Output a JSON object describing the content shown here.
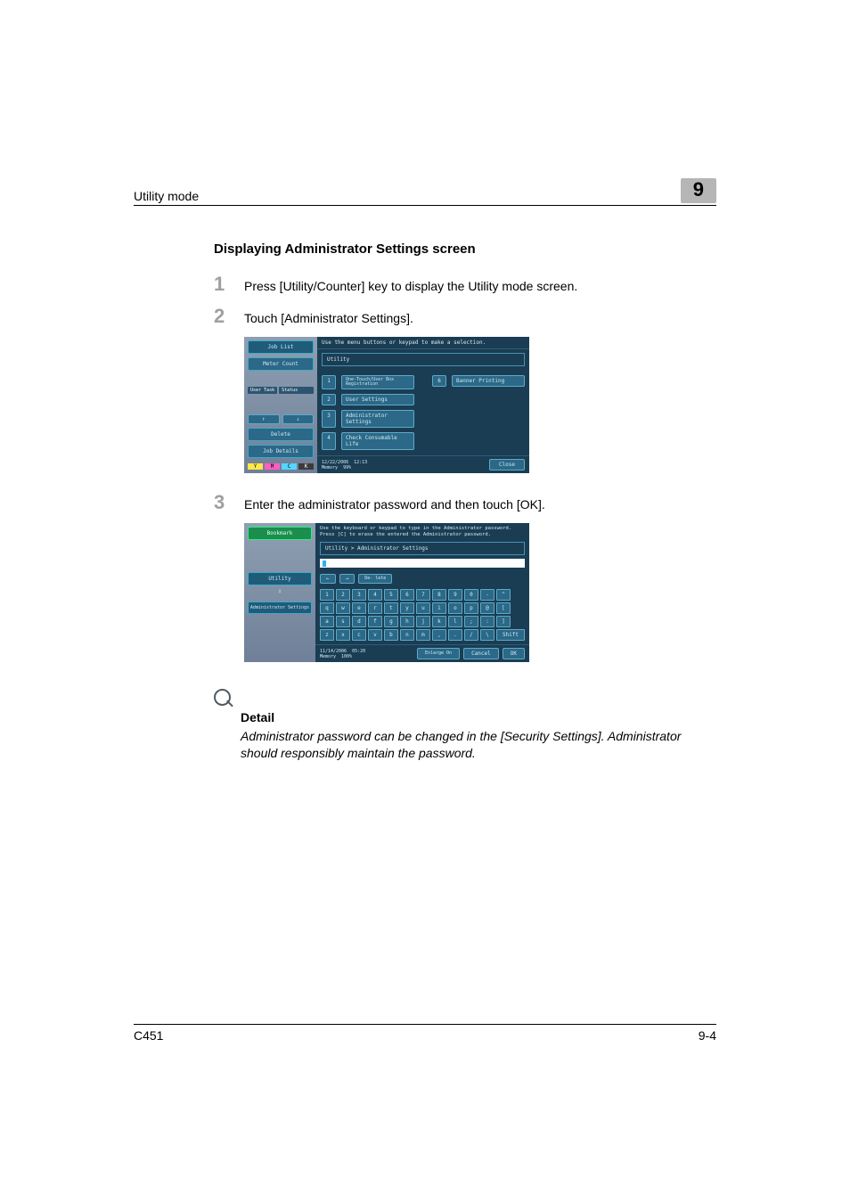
{
  "header": {
    "section": "Utility mode",
    "chapter": "9"
  },
  "section_title": "Displaying Administrator Settings screen",
  "steps": {
    "s1": {
      "num": "1",
      "text": "Press [Utility/Counter] key to display the Utility mode screen."
    },
    "s2": {
      "num": "2",
      "text": "Touch [Administrator Settings]."
    },
    "s3": {
      "num": "3",
      "text": "Enter the administrator password and then touch [OK]."
    }
  },
  "shot1": {
    "side": {
      "job_list": "Job List",
      "meter_count": "Meter Count",
      "user_task": "User Task",
      "status": "Status",
      "up": "↑",
      "down": "↓",
      "delete": "Delete",
      "job_details": "Job Details",
      "y": "Y",
      "m": "M",
      "c": "C",
      "k": "K"
    },
    "instr": "Use the menu buttons or keypad to make a selection.",
    "title": "Utility",
    "items": [
      {
        "num": "1",
        "label": "One-Touch/User Box Registration"
      },
      {
        "num": "2",
        "label": "User Settings"
      },
      {
        "num": "3",
        "label": "Administrator Settings"
      },
      {
        "num": "4",
        "label": "Check Consumable Life"
      },
      {
        "num": "6",
        "label": "Banner Printing"
      }
    ],
    "footer": {
      "date": "12/22/2006",
      "time": "12:13",
      "mem": "Memory",
      "pct": "99%",
      "close": "Close"
    }
  },
  "shot2": {
    "side": {
      "bookmark": "Bookmark",
      "utility": "Utility",
      "admin": "Administrator Settings"
    },
    "instr1": "Use the keyboard or keypad to type in the Administrator password.",
    "instr2": "Press [C] to erase the entered the Administrator password.",
    "breadcrumb": "Utility > Administrator Settings",
    "ctrl": {
      "left": "←",
      "right": "→",
      "del": "De- lete"
    },
    "rows": [
      [
        "1",
        "2",
        "3",
        "4",
        "5",
        "6",
        "7",
        "8",
        "9",
        "0",
        "-",
        "^"
      ],
      [
        "q",
        "w",
        "e",
        "r",
        "t",
        "y",
        "u",
        "i",
        "o",
        "p",
        "@",
        "["
      ],
      [
        "a",
        "s",
        "d",
        "f",
        "g",
        "h",
        "j",
        "k",
        "l",
        ";",
        ":",
        "]"
      ],
      [
        "z",
        "x",
        "c",
        "v",
        "b",
        "n",
        "m",
        ",",
        ".",
        "/",
        "\\"
      ]
    ],
    "shift": "Shift",
    "footer": {
      "date": "11/14/2006",
      "time": "05:20",
      "mem": "Memory",
      "pct": "100%",
      "enlarge": "Enlarge On",
      "cancel": "Cancel",
      "ok": "OK"
    }
  },
  "detail": {
    "title": "Detail",
    "text": "Administrator password can be changed in the [Security Settings]. Administrator should responsibly maintain the password."
  },
  "footer": {
    "model": "C451",
    "page": "9-4"
  }
}
